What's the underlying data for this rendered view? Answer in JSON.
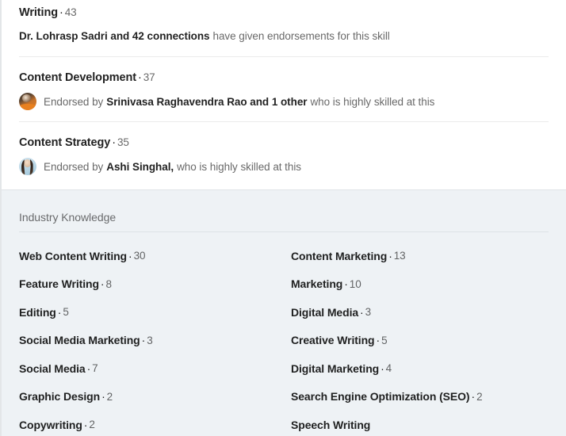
{
  "endorsed_skills": [
    {
      "name": "Writing",
      "count": "43",
      "separator": "·",
      "has_avatar": false,
      "avatar_style": "",
      "endorsement": {
        "prefix": "",
        "strong": "Dr. Lohrasp Sadri and 42 connections",
        "suffix": "have given endorsements for this skill"
      }
    },
    {
      "name": "Content Development",
      "count": "37",
      "separator": "·",
      "has_avatar": true,
      "avatar_style": "a1",
      "endorsement": {
        "prefix": "Endorsed by",
        "strong": "Srinivasa Raghavendra Rao and 1 other",
        "suffix": "who is highly skilled at this"
      }
    },
    {
      "name": "Content Strategy",
      "count": "35",
      "separator": "·",
      "has_avatar": true,
      "avatar_style": "a2",
      "endorsement": {
        "prefix": "Endorsed by",
        "strong": "Ashi Singhal,",
        "suffix": "who is highly skilled at this"
      }
    }
  ],
  "industry_knowledge": {
    "label": "Industry Knowledge",
    "separator": "·",
    "skills_left": [
      {
        "name": "Web Content Writing",
        "count": "30"
      },
      {
        "name": "Feature Writing",
        "count": "8"
      },
      {
        "name": "Editing",
        "count": "5"
      },
      {
        "name": "Social Media Marketing",
        "count": "3"
      },
      {
        "name": "Social Media",
        "count": "7"
      },
      {
        "name": "Graphic Design",
        "count": "2"
      },
      {
        "name": "Copywriting",
        "count": "2"
      }
    ],
    "skills_right": [
      {
        "name": "Content Marketing",
        "count": "13"
      },
      {
        "name": "Marketing",
        "count": "10"
      },
      {
        "name": "Digital Media",
        "count": "3"
      },
      {
        "name": "Creative Writing",
        "count": "5"
      },
      {
        "name": "Digital Marketing",
        "count": "4"
      },
      {
        "name": "Search Engine Optimization (SEO)",
        "count": "2"
      },
      {
        "name": "Speech Writing",
        "count": ""
      }
    ]
  },
  "colors": {
    "page_background": "#ffffff",
    "section_background": "#eef2f5",
    "divider": "#ebebeb",
    "text_primary": "#000000de",
    "text_secondary": "#00000099"
  }
}
